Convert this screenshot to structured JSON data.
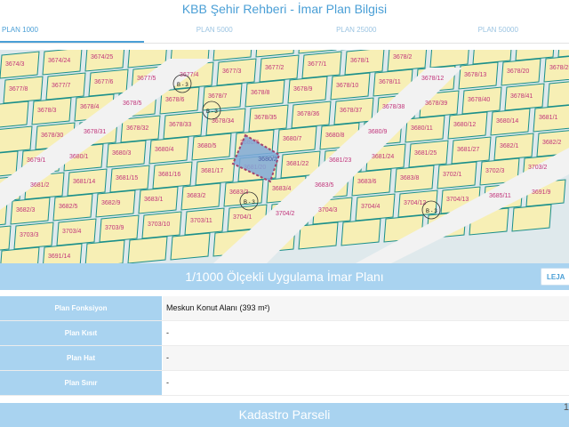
{
  "page_title": "KBB Şehir Rehberi - İmar Plan Bilgisi",
  "tabs": [
    {
      "label": "PLAN 1000",
      "active": true
    },
    {
      "label": "PLAN 5000",
      "active": false
    },
    {
      "label": "PLAN 25000",
      "active": false
    },
    {
      "label": "PLAN 50000",
      "active": false
    }
  ],
  "map": {
    "selected_parcel": "3680/2",
    "zone_labels": [
      "B - 3",
      "B - 3",
      "B - 3",
      "B - 3"
    ],
    "parcel_labels": [
      "3674/3",
      "3674/24",
      "3674/25",
      "3677/8",
      "3677/7",
      "3677/6",
      "3677/5",
      "3677/4",
      "3677/3",
      "3677/2",
      "3677/1",
      "3678/1",
      "3678/2",
      "3678/3",
      "3678/4",
      "3678/5",
      "3678/6",
      "3678/7",
      "3678/8",
      "3678/9",
      "3678/10",
      "3678/11",
      "3678/12",
      "3678/13",
      "3678/20",
      "3678/25",
      "3678/30",
      "3678/31",
      "3678/32",
      "3678/33",
      "3678/34",
      "3678/35",
      "3678/36",
      "3678/37",
      "3678/38",
      "3678/39",
      "3678/40",
      "3678/41",
      "3679/1",
      "3680/1",
      "3680/3",
      "3680/4",
      "3680/5",
      "3680/6",
      "3680/7",
      "3680/8",
      "3680/9",
      "3680/11",
      "3680/12",
      "3680/14",
      "3681/1",
      "3681/2",
      "3681/14",
      "3681/15",
      "3681/16",
      "3681/17",
      "3681/20",
      "3681/22",
      "3681/23",
      "3681/24",
      "3681/25",
      "3681/27",
      "3682/1",
      "3682/2",
      "3682/3",
      "3682/5",
      "3682/9",
      "3683/1",
      "3683/2",
      "3683/3",
      "3683/4",
      "3683/5",
      "3683/6",
      "3683/8",
      "3702/1",
      "3702/3",
      "3703/2",
      "3703/3",
      "3703/4",
      "3703/9",
      "3703/10",
      "3703/11",
      "3704/1",
      "3704/2",
      "3704/3",
      "3704/4",
      "3704/12",
      "3704/13",
      "3685/11",
      "3691/9",
      "3691/14"
    ]
  },
  "plan_section": {
    "title": "1/1000 Ölçekli Uygulama İmar Planı",
    "legend_button": "LEJA"
  },
  "info_rows": [
    {
      "key": "Plan Fonksiyon",
      "value": "Meskun Konut Alanı (393 m²)"
    },
    {
      "key": "Plan Kısıt",
      "value": "-"
    },
    {
      "key": "Plan Hat",
      "value": "-"
    },
    {
      "key": "Plan Sınır",
      "value": "-"
    }
  ],
  "cadastre_section": {
    "title": "Kadastro Parseli"
  },
  "page_number": "1"
}
